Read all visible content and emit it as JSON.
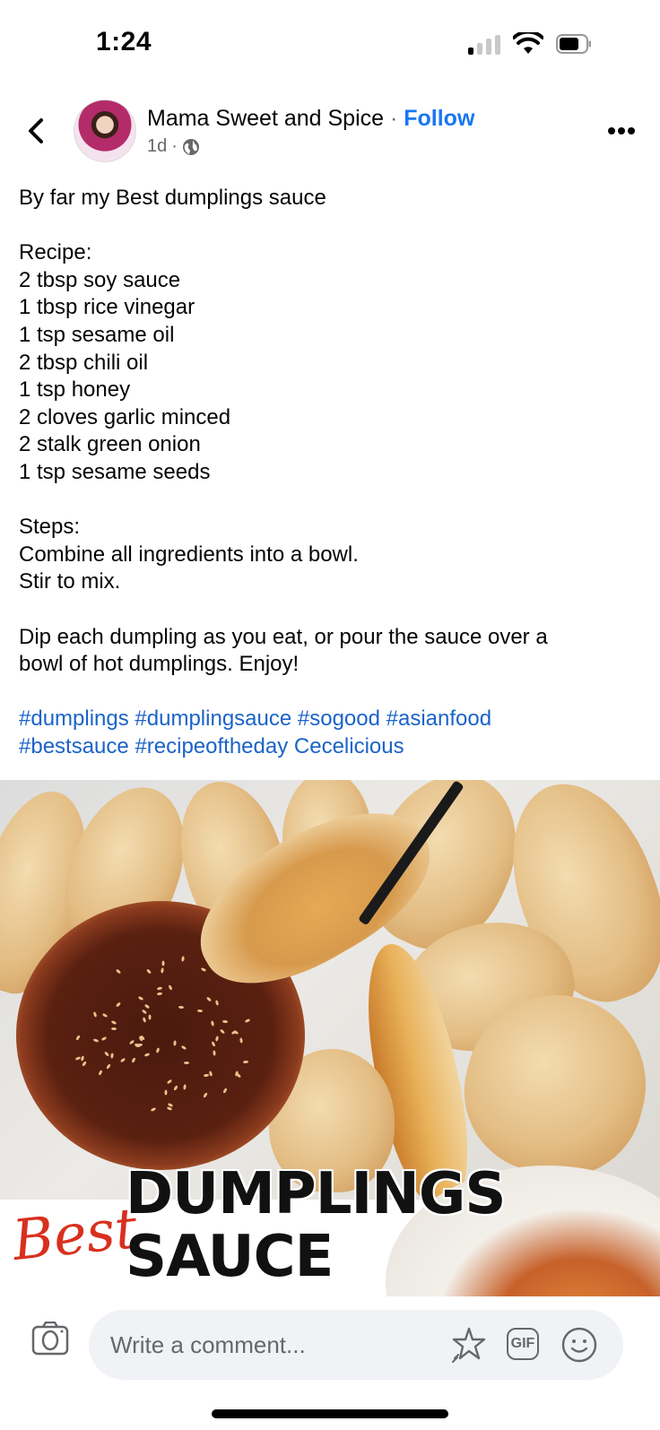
{
  "status_bar": {
    "time": "1:24",
    "signal_bars_active": 1,
    "signal_bars_total": 4,
    "wifi": "wifi-icon",
    "battery_level": 0.7
  },
  "header": {
    "back_icon": "chevron-left-icon",
    "author_name": "Mama Sweet and Spice",
    "separator": " · ",
    "follow_label": "Follow",
    "timestamp": "1d",
    "meta_separator": "·",
    "privacy_icon": "globe-icon",
    "more_icon": "more-horizontal-icon"
  },
  "post": {
    "intro": "By far my Best dumplings sauce",
    "recipe_heading": "Recipe:",
    "ingredients": [
      "2 tbsp soy sauce",
      "1 tbsp rice vinegar",
      "1 tsp sesame oil",
      "2 tbsp chili oil",
      "1 tsp honey",
      "2 cloves garlic minced",
      "2 stalk green onion",
      "1 tsp sesame seeds"
    ],
    "steps_heading": "Steps:",
    "steps": [
      "Combine all ingredients into a bowl.",
      "Stir to mix."
    ],
    "serving_line1": "Dip each dumpling as you eat, or pour the sauce over a",
    "serving_line2": "bowl of hot dumplings. Enjoy!",
    "hashtags": [
      "#dumplings",
      "#dumplingsauce",
      "#sogood",
      "#asianfood",
      "#bestsauce",
      "#recipeoftheday"
    ],
    "mention": "Cecelicious",
    "link_color": "#1b63c8"
  },
  "photo": {
    "overlay_script_word": "Best",
    "overlay_title_line1": "DUMPLINGS",
    "overlay_title_line2": "SAUCE"
  },
  "comment_bar": {
    "camera_icon": "camera-icon",
    "placeholder": "Write a comment...",
    "avatar_sticker_icon": "sticker-star-icon",
    "gif_label": "GIF",
    "emoji_icon": "smiley-icon"
  }
}
